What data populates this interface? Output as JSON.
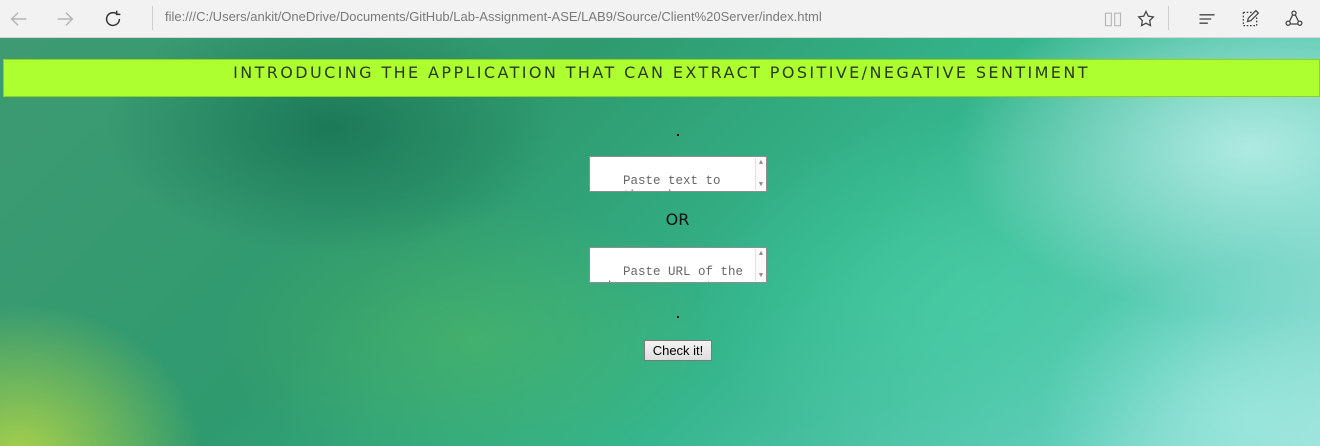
{
  "browser": {
    "address": "file:///C:/Users/ankit/OneDrive/Documents/GitHub/Lab-Assignment-ASE/LAB9/Source/Client%20Server/index.html"
  },
  "page": {
    "banner": "INTRODUCING THE APPLICATION THAT CAN EXTRACT POSITIVE/NEGATIVE SENTIMENT",
    "text_input": {
      "placeholder": "Paste text to run through sentiment"
    },
    "or_label": "OR",
    "url_input": {
      "placeholder": "Paste URL of the webpage you want"
    },
    "submit_label": "Check it!"
  },
  "colors": {
    "banner_background": "#adff2f",
    "page_background": "#35b58c"
  },
  "icons": [
    "back-arrow-icon",
    "forward-arrow-icon",
    "refresh-icon",
    "reading-view-icon",
    "favorite-star-icon",
    "hub-icon",
    "web-note-icon",
    "share-icon"
  ]
}
